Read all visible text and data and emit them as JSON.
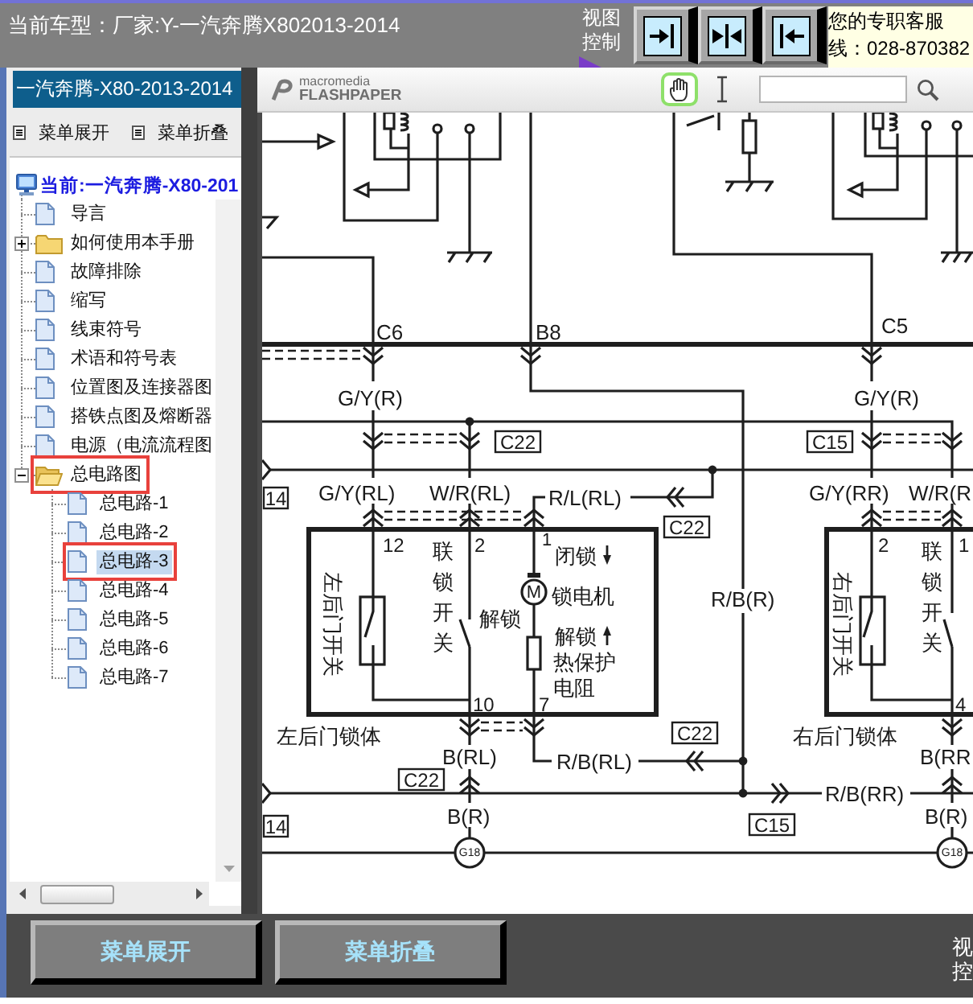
{
  "header": {
    "title": "当前车型：厂家:Y-一汽奔腾X802013-2014",
    "view_label": [
      "视图",
      "控制"
    ],
    "support": [
      "您的专职客服",
      "线：028-870382"
    ]
  },
  "sidebar": {
    "title": "一汽奔腾-X80-2013-2014",
    "actions": [
      "菜单展开",
      "菜单折叠"
    ],
    "tree": {
      "root": "当前:一汽奔腾-X80-201",
      "items": [
        {
          "label": "导言",
          "kind": "page",
          "selected": false,
          "marked": false
        },
        {
          "label": "如何使用本手册",
          "kind": "folder",
          "expanded": false,
          "selected": false,
          "marked": false
        },
        {
          "label": "故障排除",
          "kind": "page",
          "selected": false,
          "marked": false
        },
        {
          "label": "缩写",
          "kind": "page",
          "selected": false,
          "marked": false
        },
        {
          "label": "线束符号",
          "kind": "page",
          "selected": false,
          "marked": false
        },
        {
          "label": "术语和符号表",
          "kind": "page",
          "selected": false,
          "marked": false
        },
        {
          "label": "位置图及连接器图",
          "kind": "page",
          "selected": false,
          "marked": false
        },
        {
          "label": "搭铁点图及熔断器",
          "kind": "page",
          "selected": false,
          "marked": false
        },
        {
          "label": "电源（电流流程图",
          "kind": "page",
          "selected": false,
          "marked": false
        },
        {
          "label": "总电路图",
          "kind": "folder",
          "expanded": true,
          "selected": false,
          "marked": true,
          "children": [
            {
              "label": "总电路-1",
              "kind": "page",
              "selected": false,
              "marked": false
            },
            {
              "label": "总电路-2",
              "kind": "page",
              "selected": false,
              "marked": false
            },
            {
              "label": "总电路-3",
              "kind": "page",
              "selected": true,
              "marked": true
            },
            {
              "label": "总电路-4",
              "kind": "page",
              "selected": false,
              "marked": false
            },
            {
              "label": "总电路-5",
              "kind": "page",
              "selected": false,
              "marked": false
            },
            {
              "label": "总电路-6",
              "kind": "page",
              "selected": false,
              "marked": false
            },
            {
              "label": "总电路-7",
              "kind": "page",
              "selected": false,
              "marked": false
            }
          ]
        }
      ]
    }
  },
  "toolbar": {
    "logo": [
      "macromedia",
      "FLASHPAPER"
    ],
    "tools": [
      {
        "kind": "hand",
        "selected": true
      },
      {
        "kind": "text",
        "selected": false
      }
    ]
  },
  "diagram": {
    "wire_labels": [
      "C6",
      "B8",
      "C5",
      "G/Y(R)",
      "G/Y(R)",
      "G/Y(RL)",
      "W/R(RL)",
      "R/L(RL)",
      "G/Y(RR)",
      "W/R(R",
      "R/B(R)",
      "B(RL)",
      "R/B(RL)",
      "B(RR",
      "R/B(RR)",
      "B(R)",
      "B(R)"
    ],
    "connector_tags": [
      "C22",
      "C15",
      "14",
      "C22",
      "C22",
      "C22",
      "14",
      "C15"
    ],
    "ground_tags": [
      "G18",
      "G18"
    ],
    "left_door_lock": {
      "name": "左后门锁体",
      "door_switch": "左后门开关",
      "interlock_switch": "联锁开关",
      "switch_note": "解锁",
      "pins": [
        "12",
        "2",
        "1",
        "10",
        "7"
      ],
      "motor": "M",
      "motor_notes": [
        "闭锁",
        "锁电机",
        "解锁"
      ],
      "resistor_note": "热保护电阻"
    },
    "right_door_lock": {
      "name": "右后门锁体",
      "door_switch": "右后门开关",
      "interlock_switch": "联锁开关",
      "pins": [
        "2",
        "1",
        "4"
      ]
    }
  },
  "bottom_bar": {
    "buttons": [
      "菜单展开",
      "菜单折叠"
    ],
    "view_label": [
      "视",
      "控"
    ]
  }
}
